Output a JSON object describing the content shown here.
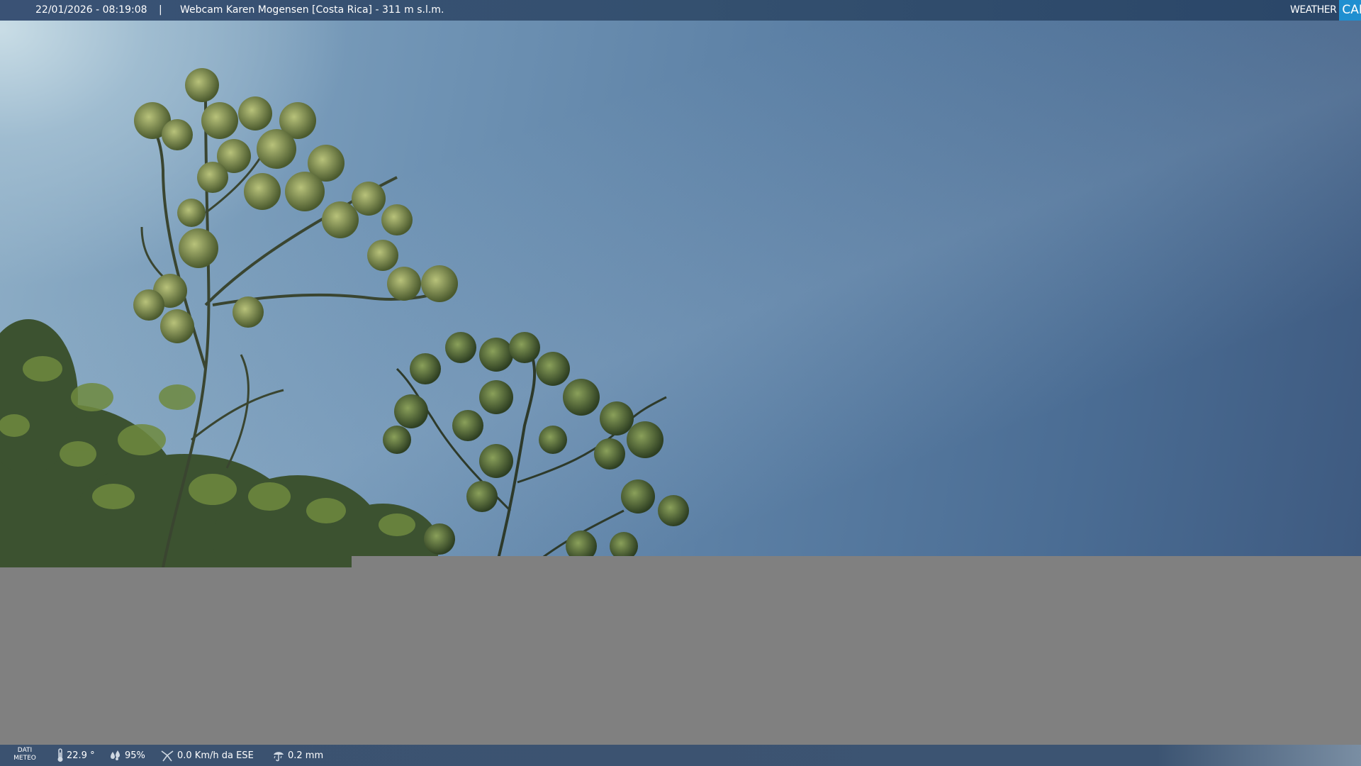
{
  "header": {
    "datetime": "22/01/2026 - 08:19:08",
    "separator": "|",
    "title": "Webcam Karen Mogensen [Costa Rica]  - 311 m s.l.m.",
    "logo": {
      "weather": "WEATHER",
      "cam": "CAM"
    }
  },
  "meteo": {
    "label_line1": "DATI",
    "label_line2": "METEO",
    "temperature": "22.9 °",
    "humidity": "95%",
    "wind": "0.0 Km/h da ESE",
    "rain": "0.2 mm"
  },
  "icons": {
    "temperature": "thermometer-icon",
    "humidity": "humidity-drops-icon",
    "wind": "wind-icon",
    "rain": "rain-icon"
  },
  "colors": {
    "bar": "#3a5275",
    "logo_accent": "#1f8fd0",
    "placeholder_gray": "#808080"
  }
}
